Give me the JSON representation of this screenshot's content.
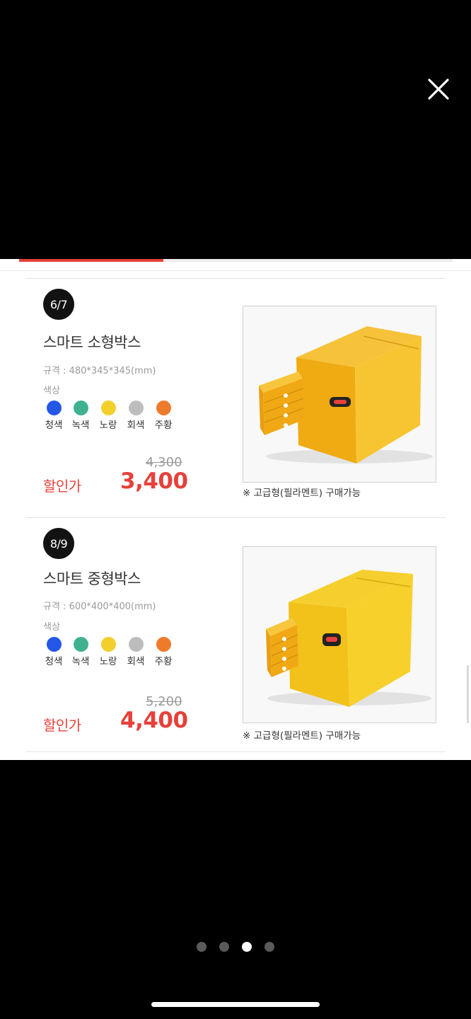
{
  "viewer": {
    "close_icon": "close-icon",
    "pagination": {
      "count": 4,
      "active_index": 2
    },
    "scroll_progress": 0.333
  },
  "products": [
    {
      "badge": "6/7",
      "title": "스마트 소형박스",
      "spec": "규격 : 480*345*345(mm)",
      "color_label": "색상",
      "colors": [
        {
          "name": "청색",
          "hex": "#2457e6"
        },
        {
          "name": "녹색",
          "hex": "#3fb191"
        },
        {
          "name": "노랑",
          "hex": "#f3cf2c"
        },
        {
          "name": "회색",
          "hex": "#bdbdbd"
        },
        {
          "name": "주황",
          "hex": "#ee7a2b"
        }
      ],
      "original_price": "4,300",
      "sale_label": "할인가",
      "sale_price": "3,400",
      "image": "yellow-smart-box-small",
      "caption": "※ 고급형(필라멘트) 구매가능"
    },
    {
      "badge": "8/9",
      "title": "스마트 중형박스",
      "spec": "규격 : 600*400*400(mm)",
      "color_label": "색상",
      "colors": [
        {
          "name": "청색",
          "hex": "#2457e6"
        },
        {
          "name": "녹색",
          "hex": "#3fb191"
        },
        {
          "name": "노랑",
          "hex": "#f3cf2c"
        },
        {
          "name": "회색",
          "hex": "#bdbdbd"
        },
        {
          "name": "주황",
          "hex": "#ee7a2b"
        }
      ],
      "original_price": "5,200",
      "sale_label": "할인가",
      "sale_price": "4,400",
      "image": "yellow-smart-box-medium",
      "caption": "※ 고급형(필라멘트) 구매가능"
    }
  ],
  "accent_color": "#e6413a"
}
